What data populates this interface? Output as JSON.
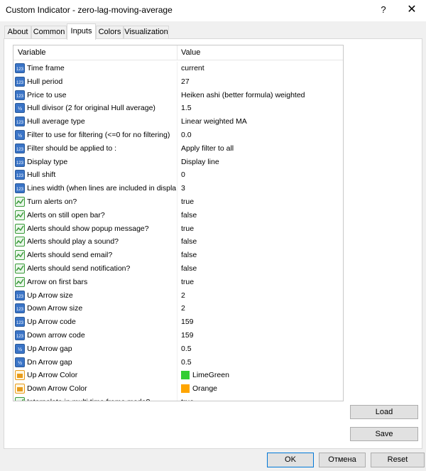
{
  "window": {
    "title": "Custom Indicator - zero-lag-moving-average",
    "help_label": "?",
    "close_label": "✕"
  },
  "tabs": [
    {
      "label": "About"
    },
    {
      "label": "Common"
    },
    {
      "label": "Inputs"
    },
    {
      "label": "Colors"
    },
    {
      "label": "Visualization"
    }
  ],
  "active_tab": "Inputs",
  "grid": {
    "header": {
      "variable": "Variable",
      "value": "Value"
    },
    "rows": [
      {
        "icon": "int-icon",
        "name": "Time frame",
        "value": "current"
      },
      {
        "icon": "int-icon",
        "name": "Hull period",
        "value": "27"
      },
      {
        "icon": "int-icon",
        "name": "Price to use",
        "value": "Heiken ashi (better formula) weighted"
      },
      {
        "icon": "double-icon",
        "name": "Hull divisor (2 for original Hull average)",
        "value": "1.5"
      },
      {
        "icon": "int-icon",
        "name": "Hull average type",
        "value": "Linear weighted MA"
      },
      {
        "icon": "double-icon",
        "name": "Filter to use for filtering (<=0 for no filtering)",
        "value": "0.0"
      },
      {
        "icon": "int-icon",
        "name": "Filter should be applied to :",
        "value": "Apply filter to all"
      },
      {
        "icon": "int-icon",
        "name": "Display type",
        "value": "Display line"
      },
      {
        "icon": "int-icon",
        "name": "Hull shift",
        "value": "0"
      },
      {
        "icon": "int-icon",
        "name": "Lines width (when lines are included in display)",
        "value": "3"
      },
      {
        "icon": "bool-icon",
        "name": "Turn alerts on?",
        "value": "true"
      },
      {
        "icon": "bool-icon",
        "name": "Alerts on still open bar?",
        "value": "false"
      },
      {
        "icon": "bool-icon",
        "name": "Alerts should show popup message?",
        "value": "true"
      },
      {
        "icon": "bool-icon",
        "name": "Alerts should play a sound?",
        "value": "false"
      },
      {
        "icon": "bool-icon",
        "name": "Alerts should send email?",
        "value": "false"
      },
      {
        "icon": "bool-icon",
        "name": "Alerts should send notification?",
        "value": "false"
      },
      {
        "icon": "bool-icon",
        "name": "Arrow on first bars",
        "value": "true"
      },
      {
        "icon": "int-icon",
        "name": "Up Arrow size",
        "value": "2"
      },
      {
        "icon": "int-icon",
        "name": "Down Arrow size",
        "value": "2"
      },
      {
        "icon": "int-icon",
        "name": "Up Arrow code",
        "value": "159"
      },
      {
        "icon": "int-icon",
        "name": "Down arrow code",
        "value": "159"
      },
      {
        "icon": "double-icon",
        "name": "Up Arrow gap",
        "value": "0.5"
      },
      {
        "icon": "double-icon",
        "name": "Dn Arrow gap",
        "value": "0.5"
      },
      {
        "icon": "color-icon",
        "name": "Up Arrow Color",
        "value": "LimeGreen",
        "color": "#32cd32"
      },
      {
        "icon": "color-icon",
        "name": "Down Arrow Color",
        "value": "Orange",
        "color": "#ffa500"
      },
      {
        "icon": "bool-icon",
        "name": "Interpolate in multi time frame mode?",
        "value": "true"
      }
    ]
  },
  "side_buttons": {
    "load": "Load",
    "save": "Save"
  },
  "footer_buttons": {
    "ok": "OK",
    "cancel": "Отмена",
    "reset": "Reset"
  },
  "colors": {
    "accent": "#0078d7",
    "int_icon": "#3a74c7",
    "bool_icon": "#3a9a3a",
    "color_icon": "#e89b1a"
  }
}
